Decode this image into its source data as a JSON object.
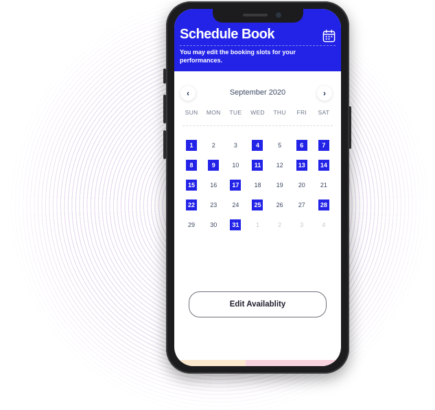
{
  "app": {
    "title": "Schedule Book",
    "subtitle": "You may edit the booking slots for your performances.",
    "header_color": "#2323E8"
  },
  "calendar": {
    "month_label": "September 2020",
    "prev_icon": "chevron-left-icon",
    "next_icon": "chevron-right-icon",
    "weekdays": [
      "SUN",
      "MON",
      "TUE",
      "WED",
      "THU",
      "FRI",
      "SAT"
    ],
    "selected_color": "#2323E8",
    "days": [
      {
        "label": "1",
        "selected": true,
        "in_month": true
      },
      {
        "label": "2",
        "selected": false,
        "in_month": true
      },
      {
        "label": "3",
        "selected": false,
        "in_month": true
      },
      {
        "label": "4",
        "selected": true,
        "in_month": true
      },
      {
        "label": "5",
        "selected": false,
        "in_month": true
      },
      {
        "label": "6",
        "selected": true,
        "in_month": true
      },
      {
        "label": "7",
        "selected": true,
        "in_month": true
      },
      {
        "label": "8",
        "selected": true,
        "in_month": true
      },
      {
        "label": "9",
        "selected": true,
        "in_month": true
      },
      {
        "label": "10",
        "selected": false,
        "in_month": true
      },
      {
        "label": "11",
        "selected": true,
        "in_month": true
      },
      {
        "label": "12",
        "selected": false,
        "in_month": true
      },
      {
        "label": "13",
        "selected": true,
        "in_month": true
      },
      {
        "label": "14",
        "selected": true,
        "in_month": true
      },
      {
        "label": "15",
        "selected": true,
        "in_month": true
      },
      {
        "label": "16",
        "selected": false,
        "in_month": true
      },
      {
        "label": "17",
        "selected": true,
        "in_month": true
      },
      {
        "label": "18",
        "selected": false,
        "in_month": true
      },
      {
        "label": "19",
        "selected": false,
        "in_month": true
      },
      {
        "label": "20",
        "selected": false,
        "in_month": true
      },
      {
        "label": "21",
        "selected": false,
        "in_month": true
      },
      {
        "label": "22",
        "selected": true,
        "in_month": true
      },
      {
        "label": "23",
        "selected": false,
        "in_month": true
      },
      {
        "label": "24",
        "selected": false,
        "in_month": true
      },
      {
        "label": "25",
        "selected": true,
        "in_month": true
      },
      {
        "label": "26",
        "selected": false,
        "in_month": true
      },
      {
        "label": "27",
        "selected": false,
        "in_month": true
      },
      {
        "label": "28",
        "selected": true,
        "in_month": true
      },
      {
        "label": "29",
        "selected": false,
        "in_month": true
      },
      {
        "label": "30",
        "selected": false,
        "in_month": true
      },
      {
        "label": "31",
        "selected": true,
        "in_month": true
      },
      {
        "label": "1",
        "selected": false,
        "in_month": false
      },
      {
        "label": "2",
        "selected": false,
        "in_month": false
      },
      {
        "label": "3",
        "selected": false,
        "in_month": false
      },
      {
        "label": "4",
        "selected": false,
        "in_month": false
      }
    ]
  },
  "actions": {
    "edit_label": "Edit Availablity"
  },
  "icons": {
    "header_icon": "calendar-icon"
  }
}
